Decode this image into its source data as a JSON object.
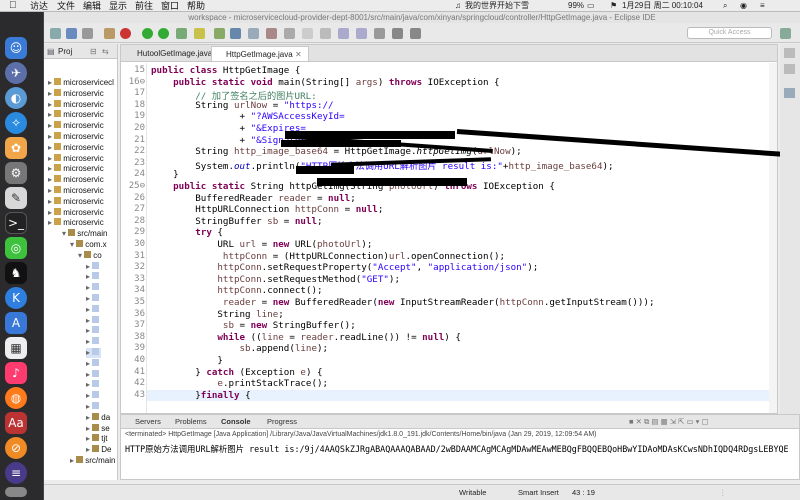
{
  "menubar": {
    "items": [
      "访达",
      "文件",
      "编辑",
      "显示",
      "前往",
      "窗口",
      "帮助"
    ],
    "right": {
      "song": "我的世界开始下雪",
      "battery": "99%",
      "datetime": "1月29日 周二  00:10:04"
    }
  },
  "window": {
    "title": "workspace - microservicecloud-provider-dept-8001/src/main/java/com/xinyan/springcloud/controller/HttpGetImage.java - Eclipse IDE",
    "quick_access_placeholder": "Quick Access"
  },
  "explorer": {
    "tab_label": "Proj",
    "projects": [
      "microservicecl",
      "microservic",
      "microservic",
      "microservic",
      "microservic",
      "microservic",
      "microservic",
      "microservic",
      "microservic",
      "microservic",
      "microservic",
      "microservic",
      "microservic",
      "microservic"
    ],
    "nodes": [
      "src/main",
      "com.x",
      "co"
    ],
    "lower": [
      "da",
      "se",
      "tjt",
      "De",
      "src/main"
    ]
  },
  "editor": {
    "tabs": [
      "HutoolGetImage.java",
      "HttpGetImage.java"
    ],
    "active_tab": 1,
    "lines": [
      {
        "n": "15",
        "html": "<span class=\"k\">public class</span> HttpGetImage {"
      },
      {
        "n": "16⊖",
        "html": "    <span class=\"k\">public static void</span> main(String[] <span class=\"v\">args</span>) <span class=\"k\">throws</span> IOException {"
      },
      {
        "n": "17",
        "html": "        <span class=\"c\">// 加了签名之后的图片URL:</span>"
      },
      {
        "n": "18",
        "html": "        String <span class=\"v\">urlNow</span> = <span class=\"s\">\"https://</span>"
      },
      {
        "n": "19",
        "html": "                + <span class=\"s\">\"?AWSAccessKeyId=</span>"
      },
      {
        "n": "20",
        "html": "                + <span class=\"s\">\"&amp;Expires=</span>"
      },
      {
        "n": "21",
        "html": "                + <span class=\"s\">\"&amp;Signature=</span>"
      },
      {
        "n": "22",
        "html": "        String <span class=\"v\">http_image_base64</span> = HttpGetImage.<span class=\"m\">httpGetImg</span>(<span class=\"v\">urlNow</span>);"
      },
      {
        "n": "23",
        "html": "        System.<span class=\"f\">out</span>.println(<span class=\"s\">\"HTTP原始方法调用URL解析图片 result is:\"</span>+<span class=\"v\">http_image_base64</span>);"
      },
      {
        "n": "24",
        "html": "    }"
      },
      {
        "n": "25⊖",
        "html": "    <span class=\"k\">public static</span> String httpGetImg(String <span class=\"v\">photoUrl</span>) <span class=\"k\">throws</span> IOException {"
      },
      {
        "n": "26",
        "html": "        BufferedReader <span class=\"v\">reader</span> = <span class=\"k\">null</span>;"
      },
      {
        "n": "27",
        "html": "        HttpURLConnection <span class=\"v\">httpConn</span> = <span class=\"k\">null</span>;"
      },
      {
        "n": "28",
        "html": "        StringBuffer <span class=\"v\">sb</span> = <span class=\"k\">null</span>;"
      },
      {
        "n": "29",
        "html": "        <span class=\"k\">try</span> {"
      },
      {
        "n": "30",
        "html": "            URL <span class=\"v\">url</span> = <span class=\"k\">new</span> URL(<span class=\"v\">photoUrl</span>);"
      },
      {
        "n": "31",
        "html": "             <span class=\"v\">httpConn</span> = (HttpURLConnection)<span class=\"v\">url</span>.openConnection();"
      },
      {
        "n": "32",
        "html": "            <span class=\"v\">httpConn</span>.setRequestProperty(<span class=\"s\">\"Accept\"</span>, <span class=\"s\">\"application/json\"</span>);"
      },
      {
        "n": "33",
        "html": "            <span class=\"v\">httpConn</span>.setRequestMethod(<span class=\"s\">\"GET\"</span>);"
      },
      {
        "n": "34",
        "html": "            <span class=\"v\">httpConn</span>.connect();"
      },
      {
        "n": "35",
        "html": "             <span class=\"v\">reader</span> = <span class=\"k\">new</span> BufferedReader(<span class=\"k\">new</span> InputStreamReader(<span class=\"v\">httpConn</span>.getInputStream()));"
      },
      {
        "n": "36",
        "html": "            String <span class=\"v\">line</span>;"
      },
      {
        "n": "37",
        "html": "             <span class=\"v\">sb</span> = <span class=\"k\">new</span> StringBuffer();"
      },
      {
        "n": "38",
        "html": "            <span class=\"k\">while</span> ((<span class=\"v\">line</span> = <span class=\"v\">reader</span>.readLine()) != <span class=\"k\">null</span>) {"
      },
      {
        "n": "39",
        "html": "                <span class=\"v\">sb</span>.append(<span class=\"v\">line</span>);"
      },
      {
        "n": "40",
        "html": "            }"
      },
      {
        "n": "41",
        "html": "        } <span class=\"k\">catch</span> (Exception <span class=\"v\">e</span>) {"
      },
      {
        "n": "42",
        "html": "            <span class=\"v\">e</span>.printStackTrace();"
      },
      {
        "n": "43",
        "html": "        }<span class=\"k\">finally</span> {"
      }
    ]
  },
  "console": {
    "tabs": [
      "Servers",
      "Problems",
      "Console",
      "Progress"
    ],
    "terminated": "<terminated> HttpGetImage [Java Application] /Library/Java/JavaVirtualMachines/jdk1.8.0_191.jdk/Contents/Home/bin/java (Jan 29, 2019, 12:09:54 AM)",
    "output": "HTTP原始方法调用URL解析图片 result is:/9j/4AAQSkZJRgABAQAAAQABAAD/2wBDAAMCAgMCAgMDAwMEAwMEBQgFBQQEBQoHBwYIDAoMDAsKCwsNDhIQDQ4RDgsLEBYQE"
  },
  "status": {
    "mode": "Writable",
    "insert": "Smart Insert",
    "position": "43 : 19"
  }
}
